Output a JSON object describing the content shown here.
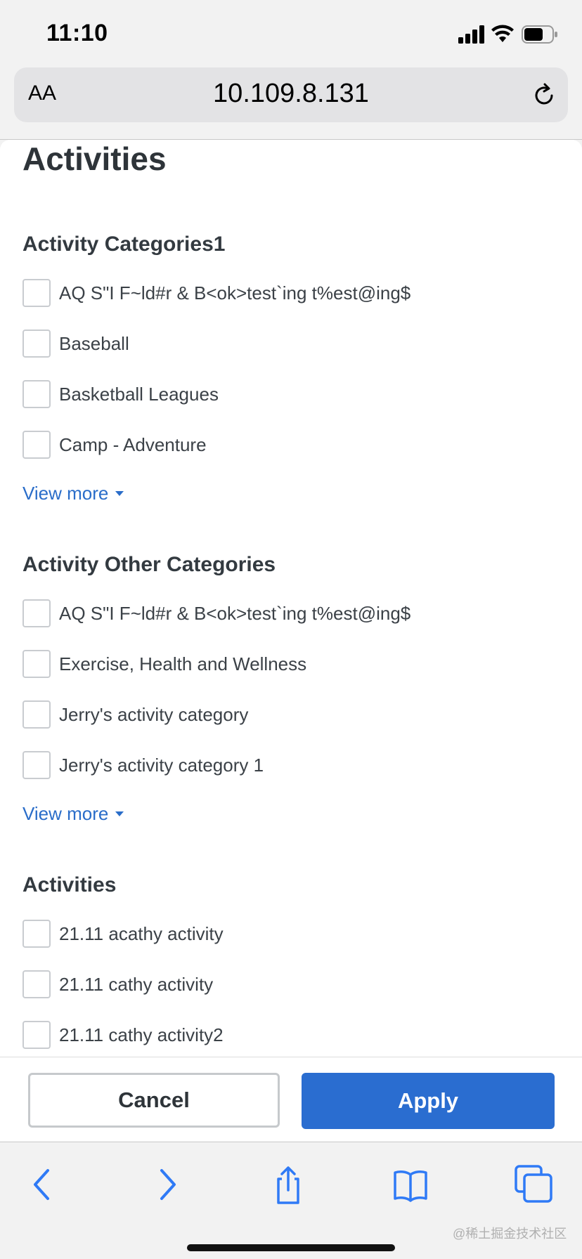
{
  "status_bar": {
    "time": "11:10"
  },
  "browser": {
    "text_size_label": "AA",
    "url": "10.109.8.131"
  },
  "page": {
    "title": "Activities"
  },
  "sections": [
    {
      "title": "Activity Categories1",
      "options": [
        "AQ S\"I F~ld#r & B<ok>test`ing t%est@ing$",
        "Baseball",
        "Basketball Leagues",
        "Camp - Adventure"
      ],
      "view_more": "View more"
    },
    {
      "title": "Activity Other Categories",
      "options": [
        "AQ S\"I F~ld#r & B<ok>test`ing t%est@ing$",
        "Exercise, Health and Wellness",
        "Jerry's activity category",
        "Jerry's activity category 1"
      ],
      "view_more": "View more"
    },
    {
      "title": "Activities",
      "options": [
        "21.11 acathy activity",
        "21.11 cathy activity",
        "21.11 cathy activity2"
      ]
    }
  ],
  "footer": {
    "cancel_label": "Cancel",
    "apply_label": "Apply"
  },
  "toolbar": {
    "icons": [
      "back-icon",
      "forward-icon",
      "share-icon",
      "bookmarks-icon",
      "tabs-icon"
    ]
  },
  "watermark": "@稀土掘金技术社区",
  "colors": {
    "accent": "#2a6dd0",
    "link": "#2a6dc9",
    "text": "#333a40"
  }
}
